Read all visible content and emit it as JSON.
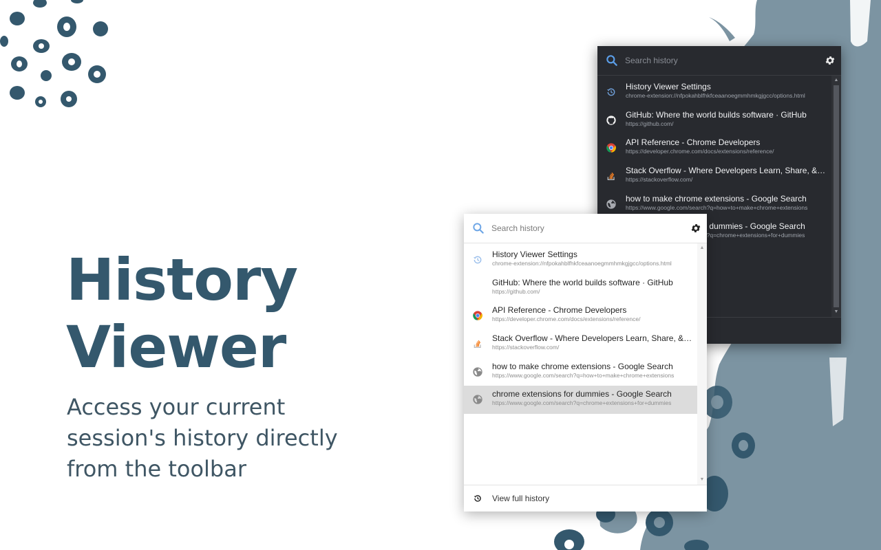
{
  "promo": {
    "title_line1": "History",
    "title_line2": "Viewer",
    "tagline_line1": "Access your current",
    "tagline_line2": "session's history directly",
    "tagline_line3": "from the toolbar"
  },
  "colors": {
    "brand": "#34586d",
    "splash": "#7c94a2",
    "dark_bg": "#282a2f",
    "selected_row": "#dcdcdc",
    "search_icon": "#4a90e2"
  },
  "dark_popup": {
    "search_placeholder": "Search history",
    "settings_icon": "gear-icon",
    "items": [
      {
        "title": "History Viewer Settings",
        "url": "chrome-extension://nfpokahblfhkfceaanoegmmhmkgjgcc/options.html",
        "icon": "history-icon"
      },
      {
        "title": "GitHub: Where the world builds software · GitHub",
        "url": "https://github.com/",
        "icon": "github-icon"
      },
      {
        "title": "API Reference - Chrome Developers",
        "url": "https://developer.chrome.com/docs/extensions/reference/",
        "icon": "chrome-icon"
      },
      {
        "title": "Stack Overflow - Where Developers Learn, Share, &amp; Build Careers",
        "url": "https://stackoverflow.com/",
        "icon": "stackoverflow-icon"
      },
      {
        "title": "how to make chrome extensions - Google Search",
        "url": "https://www.google.com/search?q=how+to+make+chrome+extensions",
        "icon": "globe-icon"
      },
      {
        "title": "chrome extensions for dummies - Google Search",
        "url": "https://www.google.com/search?q=chrome+extensions+for+dummies",
        "icon": "globe-icon"
      }
    ]
  },
  "light_popup": {
    "search_placeholder": "Search history",
    "settings_icon": "gear-icon",
    "items": [
      {
        "title": "History Viewer Settings",
        "url": "chrome-extension://nfpokahblfhkfceaanoegmmhmkgjgcc/options.html",
        "icon": "history-icon"
      },
      {
        "title": "GitHub: Where the world builds software · GitHub",
        "url": "https://github.com/",
        "icon": "github-icon"
      },
      {
        "title": "API Reference - Chrome Developers",
        "url": "https://developer.chrome.com/docs/extensions/reference/",
        "icon": "chrome-icon"
      },
      {
        "title": "Stack Overflow - Where Developers Learn, Share, &amp; Build Careers",
        "url": "https://stackoverflow.com/",
        "icon": "stackoverflow-icon"
      },
      {
        "title": "how to make chrome extensions - Google Search",
        "url": "https://www.google.com/search?q=how+to+make+chrome+extensions",
        "icon": "globe-icon"
      },
      {
        "title": "chrome extensions for dummies - Google Search",
        "url": "https://www.google.com/search?q=chrome+extensions+for+dummies",
        "icon": "globe-icon",
        "selected": true
      }
    ],
    "footer_label": "View full history",
    "footer_icon": "history-icon"
  }
}
